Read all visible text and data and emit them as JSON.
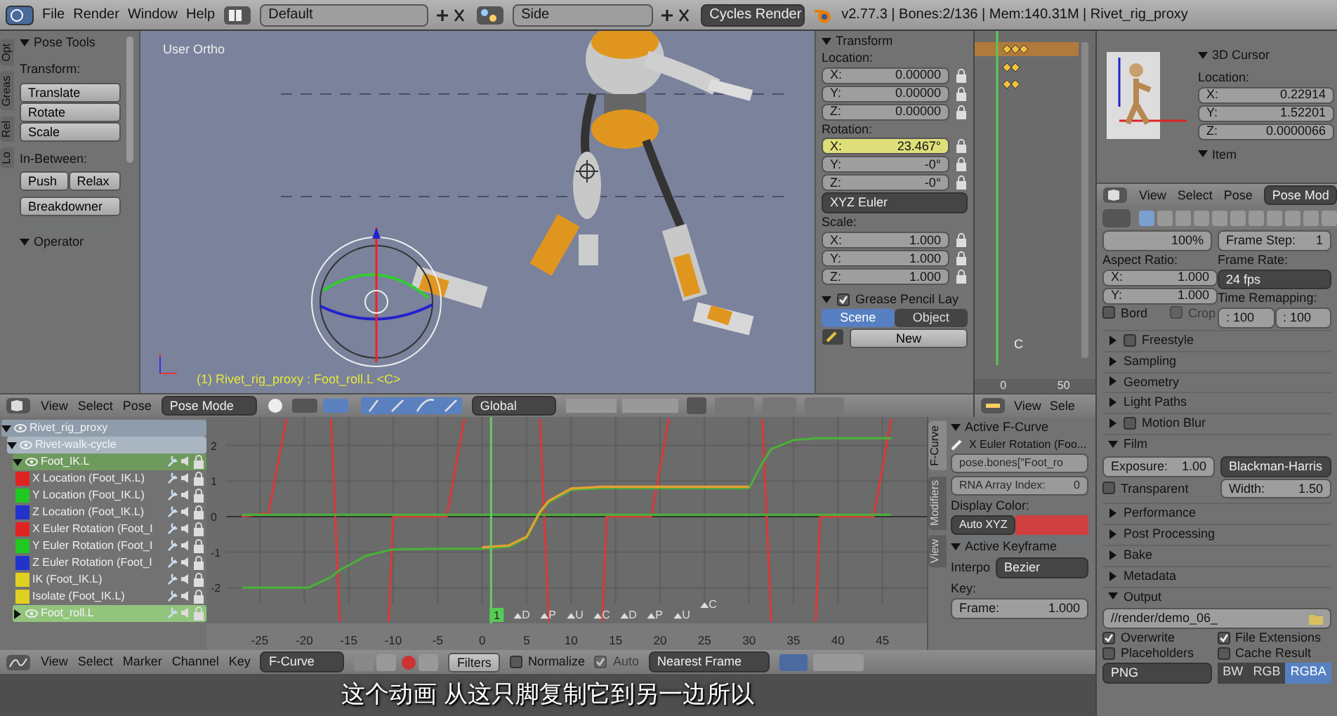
{
  "top_bar": {
    "menus": [
      "File",
      "Render",
      "Window",
      "Help"
    ],
    "screen_layout": "Default",
    "scene": "Side",
    "render_engine": "Cycles Render",
    "stats": "v2.77.3 | Bones:2/136 | Mem:140.31M | Rivet_rig_proxy"
  },
  "tool_shelf": {
    "tabs": [
      "Opt",
      "Greas",
      "Rel",
      "Lo"
    ],
    "panel_title": "Pose Tools",
    "transform_label": "Transform:",
    "transform_buttons": [
      "Translate",
      "Rotate",
      "Scale"
    ],
    "in_between_label": "In-Between:",
    "in_between_buttons": [
      "Push",
      "Relax"
    ],
    "breakdowner": "Breakdowner",
    "operator_title": "Operator"
  },
  "viewport": {
    "view_name": "User Ortho",
    "status": "(1) Rivet_rig_proxy : Foot_roll.L <C>"
  },
  "n_panel": {
    "title": "Transform",
    "location_label": "Location:",
    "location": [
      {
        "axis": "X:",
        "value": "0.00000"
      },
      {
        "axis": "Y:",
        "value": "0.00000"
      },
      {
        "axis": "Z:",
        "value": "0.00000"
      }
    ],
    "rotation_label": "Rotation:",
    "rotation": [
      {
        "axis": "X:",
        "value": "23.467°",
        "keyed": true
      },
      {
        "axis": "Y:",
        "value": "-0°",
        "keyed": false
      },
      {
        "axis": "Z:",
        "value": "-0°",
        "keyed": false
      }
    ],
    "rotation_mode": "XYZ Euler",
    "scale_label": "Scale:",
    "scale": [
      {
        "axis": "X:",
        "value": "1.000"
      },
      {
        "axis": "Y:",
        "value": "1.000"
      },
      {
        "axis": "Z:",
        "value": "1.000"
      }
    ],
    "grease_pencil": {
      "title": "Grease Pencil Lay",
      "checked": true,
      "tabs": [
        {
          "label": "Scene",
          "selected": true
        },
        {
          "label": "Object",
          "selected": false
        }
      ],
      "new_button": "New"
    }
  },
  "timeline": {
    "marker": "C",
    "frame_start": "0",
    "frame_end": "50",
    "menus": [
      "View",
      "Sele"
    ]
  },
  "view3d_header": {
    "menus": [
      "View",
      "Select",
      "Pose"
    ],
    "mode": "Pose Mode",
    "orientation": "Global"
  },
  "right_view": {
    "cursor_panel": {
      "title": "3D Cursor",
      "location_label": "Location:",
      "values": [
        {
          "axis": "X:",
          "value": "0.22914"
        },
        {
          "axis": "Y:",
          "value": "1.52201"
        },
        {
          "axis": "Z:",
          "value": "0.0000066"
        }
      ]
    },
    "item_panel": "Item",
    "menus": [
      "View",
      "Select",
      "Pose"
    ],
    "mode": "Pose Mod"
  },
  "properties": {
    "resolution": "100%",
    "frame_step": {
      "label": "Frame Step:",
      "value": "1"
    },
    "aspect_label": "Aspect Ratio:",
    "aspect": [
      {
        "axis": "X:",
        "value": "1.000"
      },
      {
        "axis": "Y:",
        "value": "1.000"
      }
    ],
    "frame_rate_label": "Frame Rate:",
    "frame_rate": "24 fps",
    "time_remapping_label": "Time Remapping:",
    "time_remap": [
      ": 100",
      ": 100"
    ],
    "border": {
      "label": "Bord",
      "checked": false
    },
    "crop": {
      "label": "Crop",
      "checked": false,
      "disabled": true
    },
    "panels": [
      {
        "title": "Freestyle",
        "kind": "toggle",
        "checked": false,
        "expanded": false
      },
      {
        "title": "Sampling",
        "kind": "plain",
        "expanded": false
      },
      {
        "title": "Geometry",
        "kind": "plain",
        "expanded": false
      },
      {
        "title": "Light Paths",
        "kind": "plain",
        "expanded": false
      },
      {
        "title": "Motion Blur",
        "kind": "toggle",
        "checked": false,
        "expanded": false
      },
      {
        "title": "Film",
        "kind": "film",
        "expanded": true,
        "exposure": {
          "label": "Exposure:",
          "value": "1.00"
        },
        "filter": "Blackman-Harris",
        "transparent": {
          "label": "Transparent",
          "checked": false
        },
        "width": {
          "label": "Width:",
          "value": "1.50"
        }
      },
      {
        "title": "Performance",
        "kind": "plain",
        "expanded": false
      },
      {
        "title": "Post Processing",
        "kind": "plain",
        "expanded": false
      },
      {
        "title": "Bake",
        "kind": "plain",
        "expanded": false
      },
      {
        "title": "Metadata",
        "kind": "plain",
        "expanded": false
      },
      {
        "title": "Output",
        "kind": "output",
        "expanded": true,
        "path": "//render/demo_06_",
        "options": [
          {
            "label": "Overwrite",
            "checked": true
          },
          {
            "label": "File Extensions",
            "checked": true
          },
          {
            "label": "Placeholders",
            "checked": false
          },
          {
            "label": "Cache Result",
            "checked": false
          }
        ],
        "format": "PNG",
        "color_modes": [
          {
            "label": "BW",
            "selected": false
          },
          {
            "label": "RGB",
            "selected": false
          },
          {
            "label": "RGBA",
            "selected": true
          }
        ]
      }
    ]
  },
  "graph_editor": {
    "channels": [
      {
        "name": "Rivet_rig_proxy",
        "kind": "object",
        "children": [
          {
            "name": "Rivet-walk-cycle",
            "kind": "action",
            "children": [
              {
                "name": "Foot_IK.L",
                "kind": "group",
                "expanded": true,
                "selected": false,
                "children": [
                  {
                    "name": "X Location (Foot_IK.L)",
                    "kind": "curve",
                    "color": "#e02222"
                  },
                  {
                    "name": "Y Location (Foot_IK.L)",
                    "kind": "curve",
                    "color": "#22c822"
                  },
                  {
                    "name": "Z Location (Foot_IK.L)",
                    "kind": "curve",
                    "color": "#2233cc"
                  },
                  {
                    "name": "X Euler Rotation (Foot_I",
                    "kind": "curve",
                    "color": "#e02222"
                  },
                  {
                    "name": "Y Euler Rotation (Foot_I",
                    "kind": "curve",
                    "color": "#22c822"
                  },
                  {
                    "name": "Z Euler Rotation (Foot_I",
                    "kind": "curve",
                    "color": "#2233cc"
                  },
                  {
                    "name": "IK (Foot_IK.L)",
                    "kind": "curve",
                    "color": "#e0d020"
                  },
                  {
                    "name": "Isolate (Foot_IK.L)",
                    "kind": "curve",
                    "color": "#e0d020"
                  }
                ]
              },
              {
                "name": "Foot_roll.L",
                "kind": "group",
                "expanded": false,
                "selected": true
              }
            ]
          }
        ]
      }
    ],
    "chart_data": {
      "type": "line",
      "grid": true,
      "xlim": [
        -31,
        50
      ],
      "ylim": [
        -3.75,
        2.8
      ],
      "xticks": [
        -25,
        -20,
        -15,
        -10,
        -5,
        0,
        5,
        10,
        15,
        20,
        25,
        30,
        35,
        40,
        45
      ],
      "yticks": [
        -2,
        -1,
        0,
        1,
        2
      ],
      "x": [
        -27,
        -24,
        -22,
        -19.5,
        -17,
        -16,
        -13,
        -10.5,
        -10,
        -4,
        -2,
        0,
        3,
        5,
        6.5,
        7.5,
        10,
        13.5,
        14,
        19,
        21,
        25,
        30,
        31.5,
        32.5,
        35,
        37.5,
        38,
        44,
        46
      ],
      "series": [
        {
          "color": "#d43b3b",
          "values": [
            0,
            0.1,
            2.75,
            null,
            2.75,
            -2.95,
            null,
            -2.95,
            0,
            0,
            2.75,
            null,
            null,
            null,
            2.75,
            -2.95,
            null,
            -2.95,
            0,
            0,
            2.75,
            null,
            null,
            2.75,
            -2.95,
            null,
            -2.95,
            0,
            0,
            2.75
          ]
        },
        {
          "color": "#4caf3a",
          "values": [
            0.05,
            0.05,
            0.05,
            0.05,
            0.05,
            0.05,
            0.05,
            0.05,
            0.05,
            0.05,
            0.05,
            0.05,
            0.05,
            0.05,
            0.05,
            0.05,
            0.05,
            0.05,
            0.05,
            0.05,
            0.05,
            0.05,
            0.05,
            0.05,
            0.05,
            0.05,
            0.05,
            0.05,
            0.05,
            0.05
          ]
        },
        {
          "color": "#4caf3a",
          "values": [
            -2,
            -2,
            -2,
            -2,
            -1.7,
            -1.5,
            -1.1,
            -0.95,
            -0.92,
            -0.9,
            -0.9,
            -0.9,
            -0.85,
            -0.6,
            0.1,
            0.4,
            0.75,
            0.8,
            0.8,
            0.8,
            0.8,
            0.8,
            0.8,
            1.5,
            1.9,
            2.15,
            2.2,
            2.2,
            2.2,
            2.2
          ]
        },
        {
          "color": "#e8a030",
          "values": [
            null,
            null,
            null,
            null,
            null,
            null,
            null,
            null,
            null,
            null,
            null,
            -0.86,
            -0.81,
            -0.56,
            0.14,
            0.44,
            0.79,
            0.84,
            0.84,
            0.84,
            0.84,
            0.84,
            0.84,
            null,
            null,
            null,
            null,
            null,
            null,
            null
          ]
        }
      ],
      "ref_lines": [
        {
          "axis": "x",
          "value": 1,
          "label": "1"
        }
      ],
      "annotations": [
        {
          "x": 4,
          "y": -2.75,
          "text": "D"
        },
        {
          "x": 7,
          "y": -2.75,
          "text": "P"
        },
        {
          "x": 10,
          "y": -2.75,
          "text": "U"
        },
        {
          "x": 13,
          "y": -2.75,
          "text": "C"
        },
        {
          "x": 16,
          "y": -2.75,
          "text": "D"
        },
        {
          "x": 19,
          "y": -2.75,
          "text": "P"
        },
        {
          "x": 22,
          "y": -2.75,
          "text": "U"
        },
        {
          "x": 25,
          "y": -2.45,
          "text": "C"
        }
      ]
    },
    "sidebar": {
      "tabs": [
        {
          "label": "F-Curve",
          "selected": true
        },
        {
          "label": "Modifiers",
          "selected": false
        },
        {
          "label": "View",
          "selected": false
        }
      ],
      "active_fcurve": {
        "title": "Active F-Curve",
        "name": "X Euler Rotation (Foo...",
        "data_path": "pose.bones[\"Foot_ro",
        "array_index": {
          "label": "RNA Array Index:",
          "value": "0"
        },
        "display_color_label": "Display Color:",
        "color_mode": "Auto XYZ",
        "color": "#d04040"
      },
      "active_keyframe": {
        "title": "Active Keyframe",
        "interpolation_label": "Interpo",
        "interpolation": "Bezier",
        "key_label": "Key:",
        "frame": {
          "label": "Frame:",
          "value": "1.000"
        }
      }
    },
    "header": {
      "menus": [
        "View",
        "Select",
        "Marker",
        "Channel",
        "Key"
      ],
      "mode": "F-Curve",
      "filters": "Filters",
      "normalize": {
        "label": "Normalize",
        "checked": false
      },
      "auto": {
        "label": "Auto",
        "checked": true,
        "disabled": true
      },
      "snap": "Nearest Frame"
    }
  },
  "subtitle": "这个动画 从这只脚复制它到另一边所以"
}
